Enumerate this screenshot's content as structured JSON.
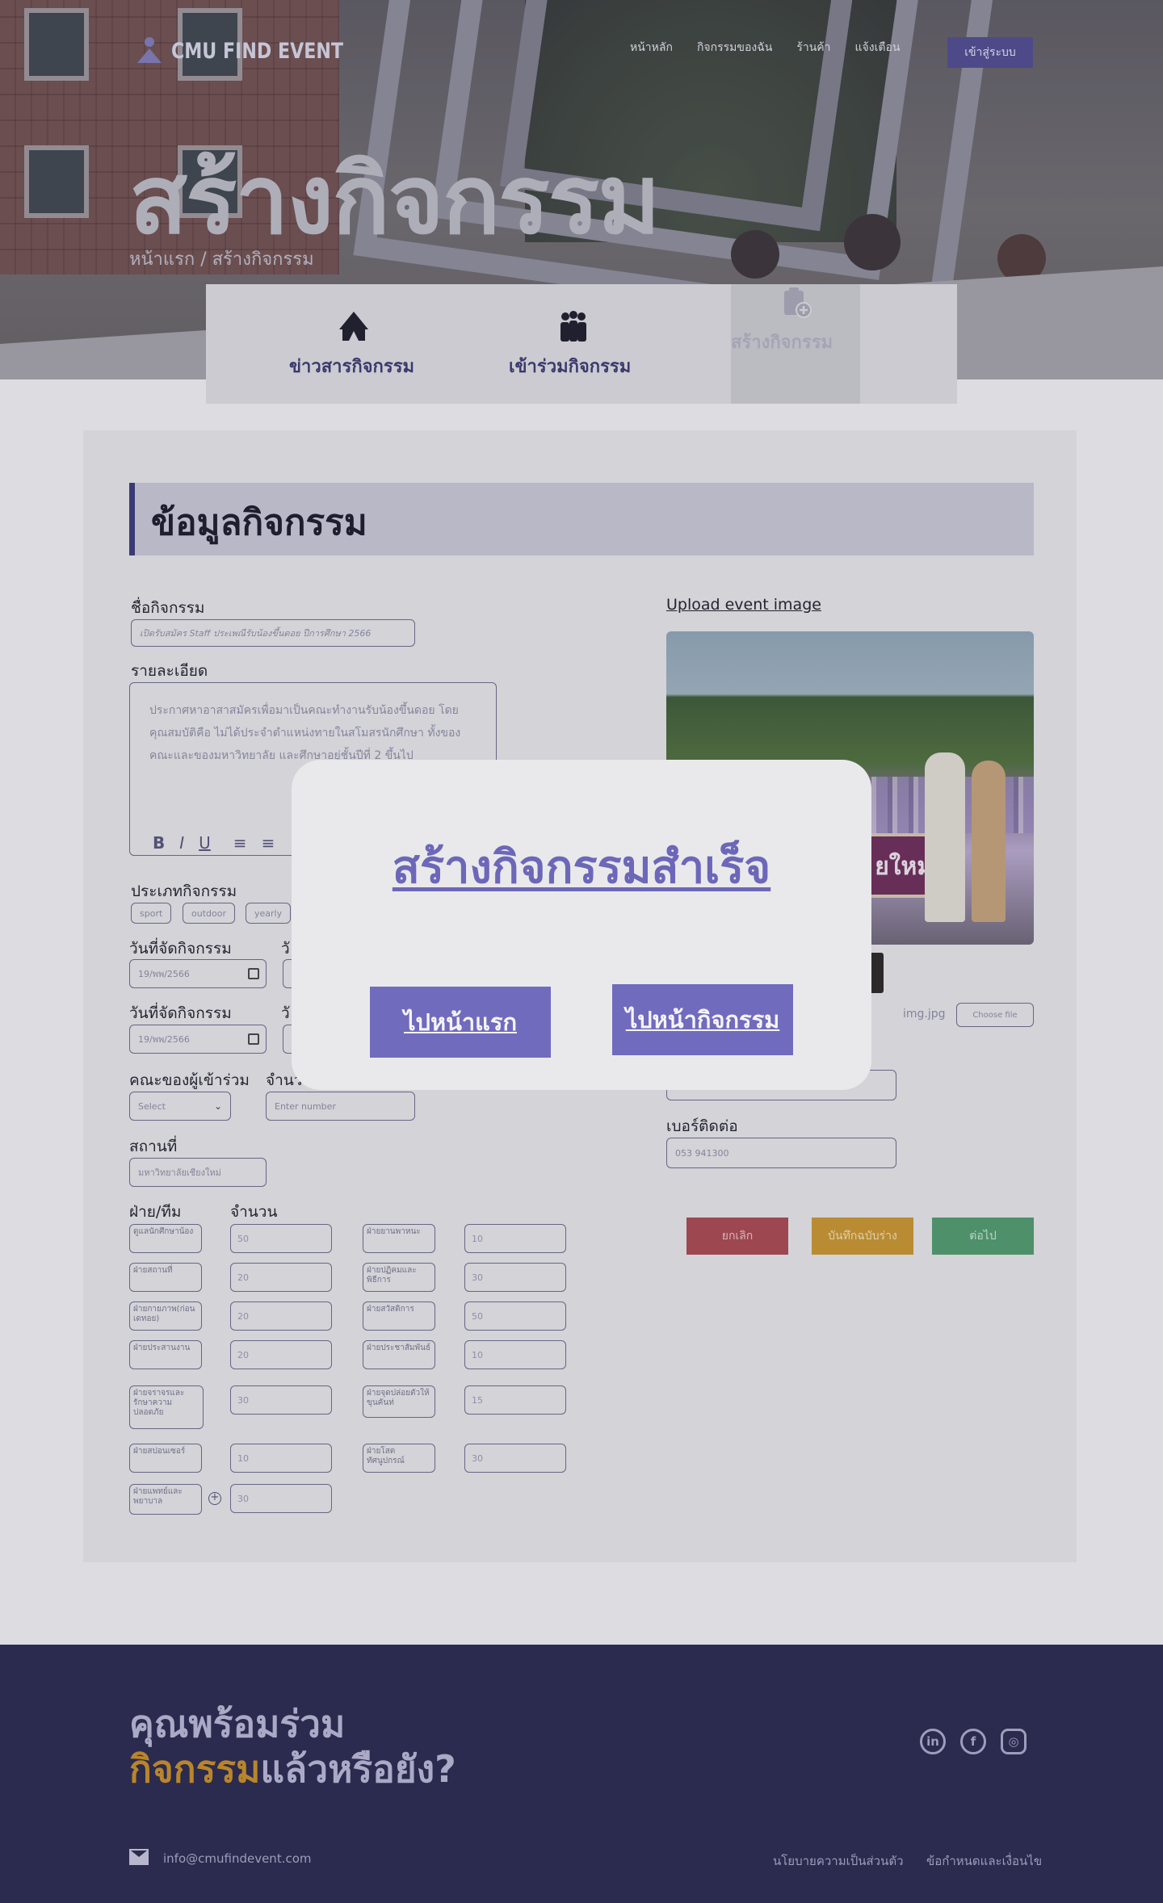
{
  "nav": {
    "logo_text": "CMU FIND EVENT",
    "links": [
      "หน้าหลัก",
      "กิจกรรมของฉัน",
      "ร้านค้า",
      "แจ้งเตือน"
    ],
    "login": "เข้าสู่ระบบ"
  },
  "hero": {
    "title": "สร้างกิจกรรม",
    "breadcrumb": "หน้าแรก / สร้างกิจกรรม"
  },
  "tabs": [
    {
      "label": "ข่าวสารกิจกรรม",
      "icon": "tent-icon"
    },
    {
      "label": "เข้าร่วมกิจกรรม",
      "icon": "people-icon"
    },
    {
      "label": "สร้างกิจกรรม",
      "icon": "clipboard-add-icon"
    }
  ],
  "form": {
    "section_title": "ข้อมูลกิจกรรม",
    "name_label": "ชื่อกิจกรรม",
    "name_value": "เปิดรับสมัคร Staff ประเพณีรับน้องขึ้นดอย ปีการศึกษา 2566",
    "detail_label": "รายละเอียด",
    "detail_value": "ประกาศหาอาสาสมัครเพื่อมาเป็นคณะทำงานรับน้องขึ้นดอย โดยคุณสมบัติคือ ไม่ได้ประจำตำแหน่งทายในสโมสรนักศึกษา ทั้งของคณะและของมหาวิทยาลัย และศึกษาอยู่ชั้นปีที่ 2 ขึ้นไป",
    "toolbar": [
      "B",
      "I",
      "U",
      "≡",
      "≡"
    ],
    "type_label": "ประเภทกิจกรรม",
    "type_chips": [
      "sport",
      "outdoor",
      "yearly"
    ],
    "date_label_1": "วันที่จัดกิจกรรม",
    "date_value_1": "19/พพ/2566",
    "date_label_2": "วันที่จัดกิจกรรม",
    "date_value_2": "19/พพ/2566",
    "col2_cut_1": "วั",
    "col2_cut_2": "วั",
    "faculty_label": "คณะของผู้เข้าร่วม",
    "faculty_value": "Select",
    "count_label": "จำนว",
    "count_placeholder": "Enter number",
    "place_label": "สถานที่",
    "place_value": "มหาวิทยาลัยเชียงใหม่",
    "team_label": "ฝ่าย/ทีม",
    "team_count_label": "จำนวน",
    "teams_left": [
      {
        "name": "ดูแลนักศึกษาน้อง",
        "count": "50"
      },
      {
        "name": "ฝ่ายสถานที่",
        "count": "20"
      },
      {
        "name": "ฝ่ายกายภาพ(ก่อนเดทอย)",
        "count": "20"
      },
      {
        "name": "ฝ่ายประสานงาน",
        "count": "20"
      },
      {
        "name": "ฝ่ายจราจรและรักษาความปลอดภัย",
        "count": "30"
      },
      {
        "name": "ฝ่ายสปอนเซอร์",
        "count": "10"
      },
      {
        "name": "ฝ่ายแพทย์และพยาบาล",
        "count": "30"
      }
    ],
    "teams_right": [
      {
        "name": "ฝ่ายยานพาหนะ",
        "count": "10"
      },
      {
        "name": "ฝ่ายปฏิคมและพิธีการ",
        "count": "30"
      },
      {
        "name": "ฝ่ายสวัสดิการ",
        "count": "50"
      },
      {
        "name": "ฝ่ายประชาสัมพันธ์",
        "count": "10"
      },
      {
        "name": "ฝ่ายจุดปล่อยตัวให้ขุนคันท่",
        "count": "15"
      },
      {
        "name": "ฝ่ายโสตทัศนูปกรณ์",
        "count": "30"
      }
    ],
    "upload_label": "Upload event image",
    "banner_text": "ยใหม่",
    "file_name": "img.jpg",
    "choose_file": "Choose file",
    "phone_label": "เบอร์ติดต่อ",
    "phone_value": "053 941300",
    "cancel": "ยกเลิก",
    "draft": "บันทึกฉบับร่าง",
    "next": "ต่อไป"
  },
  "modal": {
    "title": "สร้างกิจกรรมสำเร็จ",
    "btn_home": "ไปหน้าแรก",
    "btn_events": "ไปหน้ากิจกรรม"
  },
  "footer": {
    "line1": "คุณพร้อมร่วม",
    "line2_highlight": "กิจกรรม",
    "line2_rest": "แล้วหรือยัง?",
    "email": "info@cmufindevent.com",
    "privacy": "นโยบายความเป็นส่วนตัว",
    "terms": "ข้อกำหนดและเงื่อนไข",
    "social": [
      "linkedin-icon",
      "facebook-icon",
      "instagram-icon"
    ]
  },
  "colors": {
    "accent": "#716bbd",
    "cancel": "#a9474f",
    "draft": "#c9962e",
    "next": "#4f9a6d",
    "footer_bg": "#2b2a4f"
  }
}
